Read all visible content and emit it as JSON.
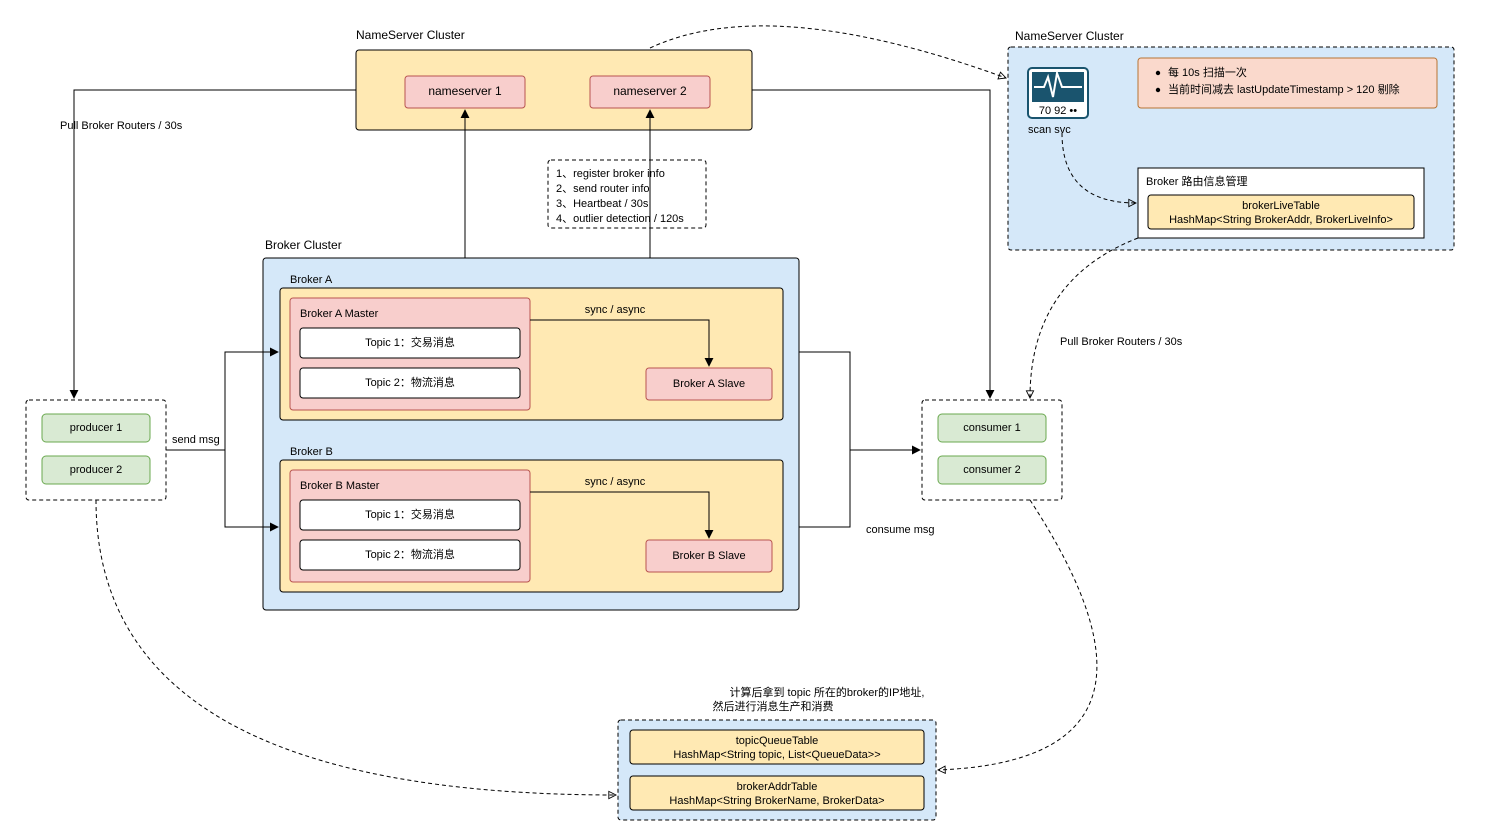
{
  "nsCluster1": {
    "title": "NameServer  Cluster",
    "ns1": "nameserver 1",
    "ns2": "nameserver 2"
  },
  "nsCluster2": {
    "title": "NameServer Cluster",
    "scanSvc": "scan svc",
    "ecgNums": "70  92  ••",
    "rules": [
      "每 10s 扫描一次",
      "当前时间减去 lastUpdateTimestamp > 120 剔除"
    ],
    "routeBox": {
      "title": "Broker 路由信息管理",
      "line1": "brokerLiveTable",
      "line2": "HashMap<String BrokerAddr, BrokerLiveInfo>"
    }
  },
  "brokerCluster": {
    "title": "Broker Cluster",
    "a": {
      "title": "Broker A",
      "master": "Broker A Master",
      "topic1": "Topic 1：交易消息",
      "topic2": "Topic 2：物流消息",
      "slave": "Broker A Slave",
      "syncLabel": "sync / async"
    },
    "b": {
      "title": "Broker B",
      "master": "Broker B Master",
      "topic1": "Topic 1：交易消息",
      "topic2": "Topic 2：物流消息",
      "slave": "Broker B Slave",
      "syncLabel": "sync / async"
    }
  },
  "producers": {
    "p1": "producer 1",
    "p2": "producer 2"
  },
  "consumers": {
    "c1": "consumer 1",
    "c2": "consumer 2"
  },
  "labels": {
    "pullLeft": "Pull Broker Routers / 30s",
    "pullRight": "Pull Broker Routers / 30s",
    "sendMsg": "send  msg",
    "consumeMsg": "consume msg",
    "regNotes": [
      "1、register broker info",
      "2、send router info",
      "3、Heartbeat / 30s",
      "4、outlier detection / 120s"
    ],
    "bottomTitle1": "计算后拿到 topic 所在的broker的IP地址,",
    "bottomTitle2": "然后进行消息生产和消费"
  },
  "bottom": {
    "t1l1": "topicQueueTable",
    "t1l2": "HashMap<String topic, List<QueueData>>",
    "t2l1": "brokerAddrTable",
    "t2l2": "HashMap<String BrokerName, BrokerData>"
  }
}
